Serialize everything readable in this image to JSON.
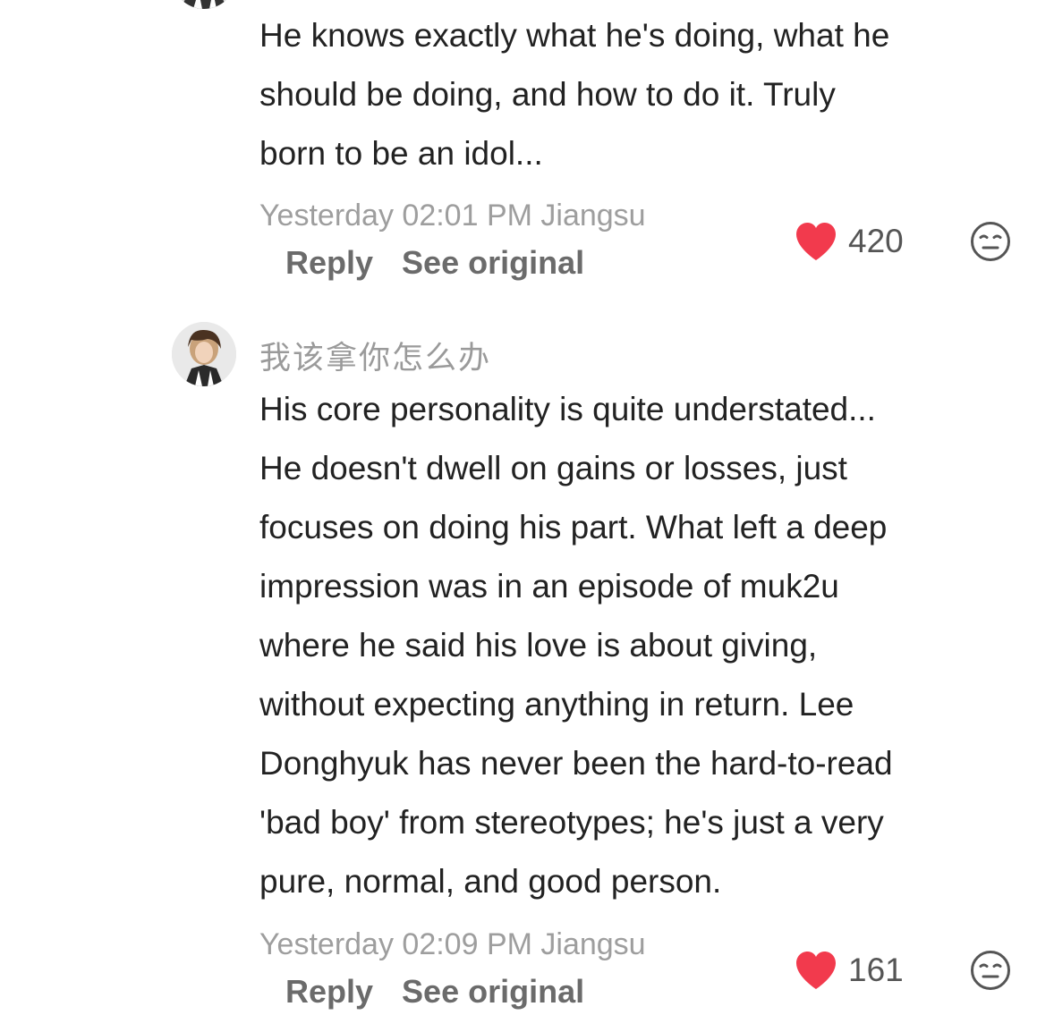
{
  "comments": [
    {
      "username": "",
      "text": "He knows exactly what he's doing, what he\nshould be doing, and how to do it. Truly\nborn to be an idol...",
      "meta": "Yesterday 02:01 PM Jiangsu",
      "reply_label": "Reply",
      "see_original_label": "See original",
      "likes": "420"
    },
    {
      "username": "我该拿你怎么办",
      "text": "His core personality is quite understated...\nHe doesn't dwell on gains or losses, just\nfocuses on doing his part. What left a deep\nimpression was in an episode of muk2u\nwhere he said his love is about giving,\nwithout expecting anything in return. Lee\nDonghyuk has never been the hard-to-read\n'bad boy' from stereotypes; he's just a very\npure, normal, and good person.",
      "meta": "Yesterday 02:09 PM Jiangsu",
      "reply_label": "Reply",
      "see_original_label": "See original",
      "likes": "161"
    }
  ],
  "icons": {
    "like": "heart-icon",
    "reaction": "expressionless-face-icon",
    "avatar": "user-avatar"
  },
  "colors": {
    "heart": "#f23a4d",
    "meta_text": "#9e9e9e",
    "action_text": "#6b6b6b",
    "body_text": "#222222"
  }
}
